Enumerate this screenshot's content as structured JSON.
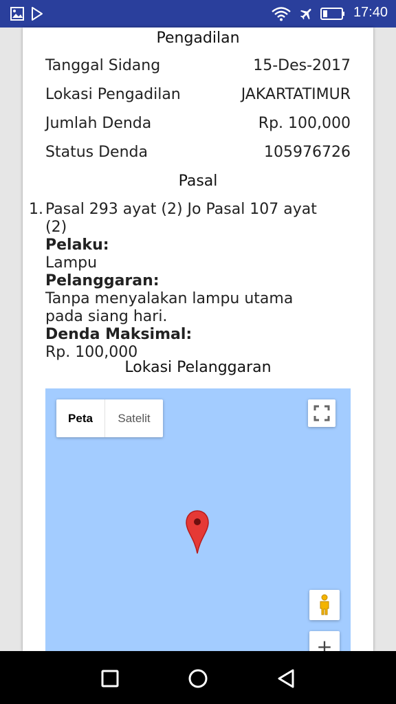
{
  "status_bar": {
    "time": "17:40",
    "icons": [
      "image-icon",
      "play-store-icon",
      "wifi-icon",
      "airplane-icon",
      "battery-icon"
    ]
  },
  "pengadilan": {
    "heading": "Pengadilan",
    "rows": [
      {
        "label": "Tanggal Sidang",
        "value": "15-Des-2017"
      },
      {
        "label": "Lokasi Pengadilan",
        "value": "JAKARTATIMUR"
      },
      {
        "label": "Jumlah Denda",
        "value": "Rp. 100,000"
      },
      {
        "label": "Status Denda",
        "value": "105976726"
      }
    ]
  },
  "pasal": {
    "heading": "Pasal",
    "number": "1.",
    "title_line1": "Pasal 293 ayat (2) Jo Pasal 107 ayat",
    "title_line2": "(2)",
    "pelaku_label": "Pelaku:",
    "pelaku_value": "Lampu",
    "pelanggaran_label": "Pelanggaran:",
    "pelanggaran_line1": "Tanpa menyalakan lampu utama",
    "pelanggaran_line2": "pada siang hari.",
    "denda_label": "Denda Maksimal:",
    "denda_value": "Rp. 100,000"
  },
  "lokasi": {
    "heading": "Lokasi Pelanggaran",
    "map": {
      "type_peta": "Peta",
      "type_satelit": "Satelit",
      "zoom_in": "+"
    }
  },
  "colors": {
    "status_bar": "#2a3f9c",
    "map_water": "#a3ccff",
    "marker": "#e53935"
  }
}
